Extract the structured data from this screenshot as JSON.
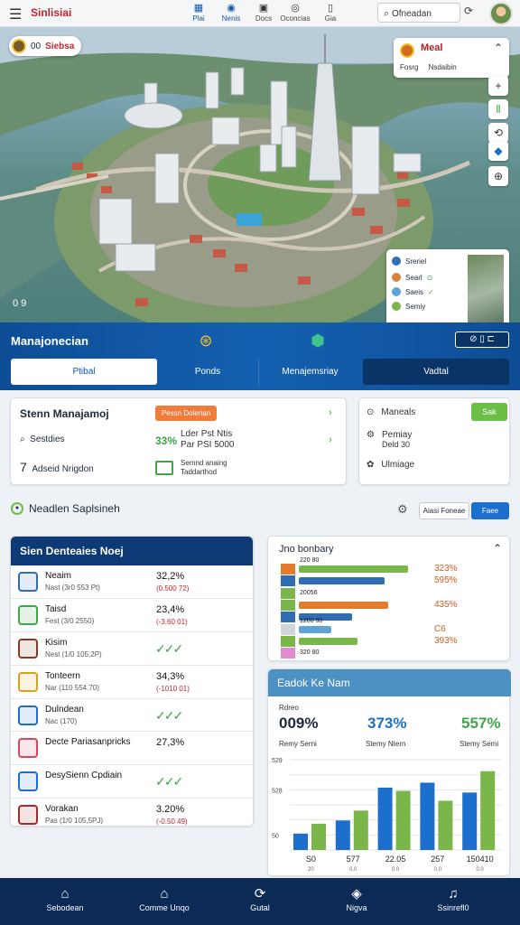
{
  "topbar": {
    "brand": "Sinlisiai",
    "nav": [
      {
        "label": "Plai",
        "icon": "building-icon"
      },
      {
        "label": "Nenis",
        "icon": "location-pin-icon"
      },
      {
        "label": "Docs",
        "icon": "grid-icon"
      },
      {
        "label": "Oconcias",
        "icon": "compass-icon"
      },
      {
        "label": "Gia",
        "icon": "document-icon"
      }
    ],
    "search_value": "Ofneadan"
  },
  "hero": {
    "badge_number": "00",
    "badge_text": "Siebsa",
    "coords": "0   9",
    "map_card": {
      "title": "Meal",
      "subtitle_left": "Fosrg",
      "subtitle_right": "Nsdaibin"
    },
    "legend": [
      {
        "label": "Sreriel",
        "color": "#2f6db5"
      },
      {
        "label": "Searl",
        "color": "#d7823a"
      },
      {
        "label": "Saeis",
        "color": "#5ea4d6"
      },
      {
        "label": "Semiy",
        "color": "#7ab64a"
      }
    ]
  },
  "management": {
    "title": "Manajonecian",
    "icon1_label": "Ponds",
    "icon2_label": "Menajemsriay",
    "tabs": [
      "Ptibal",
      "Ponds",
      "Menajemsriay",
      "Vadtal"
    ]
  },
  "system_card": {
    "title": "Stenn Manajamoj",
    "pill": "Pessn Dolerian",
    "rows": [
      {
        "label": "Sestdies",
        "icon": "search-icon"
      },
      {
        "label": "Adseid Nrigdon",
        "icon": "seven-icon"
      }
    ],
    "percent": "33%",
    "percent_sub": [
      "Lder Pst Ntis",
      "Par PSI 5000"
    ],
    "swatch_label": [
      "Semnd anaing",
      "Taddarthod"
    ]
  },
  "side_card": {
    "button": "Sak",
    "items": [
      {
        "label": "Maneals",
        "icon": "settings-icon",
        "sub": []
      },
      {
        "label": "Pemiay",
        "icon": "gear-icon",
        "sub": [
          "Deld 30"
        ]
      },
      {
        "label": "Ulmiage",
        "icon": "puzzle-icon",
        "sub": []
      }
    ]
  },
  "section": {
    "title": "Neadlen Saplsineh",
    "filter": "Aiasi Foneae",
    "button": "Faee"
  },
  "list": {
    "title": "Sien Denteaies Noej",
    "rows": [
      {
        "name": "Neaim",
        "sub": "Nast (3r0 553 Pt)",
        "value": "32,2%",
        "delta": "(0.500 72)",
        "icon_color": "#2f6db5"
      },
      {
        "name": "Taisd",
        "sub": "Fest (3/0  2550)",
        "value": "23,4%",
        "delta": "(-3.60 01)",
        "icon_color": "#3ea548"
      },
      {
        "name": "Kisim",
        "sub": "Nest (1/0 105,2P)",
        "value": "",
        "delta": "",
        "icon_color": "#8a3b1d",
        "tick": true
      },
      {
        "name": "Tonteern",
        "sub": "Nar  (110  554.70)",
        "value": "34,3%",
        "delta": "(-1010 01)",
        "icon_color": "#d6a21e"
      },
      {
        "name": "Dulndean",
        "sub": "Nac  (170)",
        "value": "",
        "delta": "",
        "icon_color": "#1c6fcd",
        "tick": true
      },
      {
        "name": "Decte Pariasanpricks",
        "sub": "",
        "value": "27,3%",
        "delta": "",
        "icon_color": "#d9475f"
      },
      {
        "name": "DesySienn Cpdiain",
        "sub": "",
        "value": "",
        "delta": "",
        "icon_color": "#1c6fcd",
        "tick": true
      },
      {
        "name": "Vorakan",
        "sub": "Pas  (1/0  105,5PJ)",
        "value": "3.20%",
        "delta": "(-0.50 49)",
        "icon_color": "#a52a2a"
      }
    ]
  },
  "bar_card": {
    "title": "Jno bonbary",
    "rows": [
      {
        "label": "220 80",
        "value": 0.67,
        "color": "#7ab64a",
        "tag_color": "#e27b2a",
        "pct": "323%"
      },
      {
        "label": "",
        "value": 0.53,
        "color": "#2f6db5",
        "tag_color": "#2f6db5",
        "pct": "595%"
      },
      {
        "label": "20056",
        "value": 0,
        "color": "#7ab64a",
        "tag_color": "#7ab64a",
        "pct": ""
      },
      {
        "label": "",
        "value": 0.55,
        "color": "#e27b2a",
        "tag_color": "#7ab64a",
        "pct": "435%"
      },
      {
        "label": "",
        "value": 0.33,
        "color": "#2f6db5",
        "tag_color": "#2f6db5",
        "pct": ""
      },
      {
        "label": "1200 30",
        "value": 0.2,
        "color": "#5ea4d6",
        "tag_color": "#d0d5db",
        "pct": "C6"
      },
      {
        "label": "",
        "value": 0.36,
        "color": "#7ab64a",
        "tag_color": "#7ab64a",
        "pct": "393%"
      },
      {
        "label": "320 80",
        "value": 0,
        "color": "#7ab64a",
        "tag_color": "#e38bd1",
        "pct": ""
      }
    ]
  },
  "column_chart": {
    "title": "Eadok Ke Nam",
    "kpis": [
      {
        "label_top": "Rdreo",
        "value": "009%",
        "label": "Remy Serni",
        "color": "#1e2a3a"
      },
      {
        "label_top": "",
        "value": "373%",
        "label": "Stemy Ntern",
        "color": "#1c6fcd"
      },
      {
        "label_top": "",
        "value": "557%",
        "label": "Stemy Semi",
        "color": "#3ea548"
      }
    ]
  },
  "chart_data": {
    "type": "bar",
    "title": "Eadok Ke Nam",
    "yticks": [
      "529",
      "",
      "528",
      "",
      "",
      "50",
      ""
    ],
    "categories": [
      "S0",
      "577",
      "22.05",
      "257",
      "150410"
    ],
    "category_sub": [
      "20",
      "0.0",
      "0.0",
      "0.0",
      "0.0"
    ],
    "series": [
      {
        "color": "#1c6fcd",
        "values": [
          10,
          18,
          38,
          41,
          35
        ]
      },
      {
        "color": "#7ab64a",
        "values": [
          16,
          24,
          36,
          30,
          48
        ]
      }
    ],
    "ylim": [
      0,
      55
    ],
    "grid": true
  },
  "bottom_nav": [
    {
      "label": "Sebodean",
      "icon": "home-icon"
    },
    {
      "label": "Comme Unqo",
      "icon": "bank-icon"
    },
    {
      "label": "Gutal",
      "icon": "refresh-icon"
    },
    {
      "label": "Nigva",
      "icon": "layers-icon"
    },
    {
      "label": "Ssinrefl0",
      "icon": "bell-icon"
    }
  ]
}
